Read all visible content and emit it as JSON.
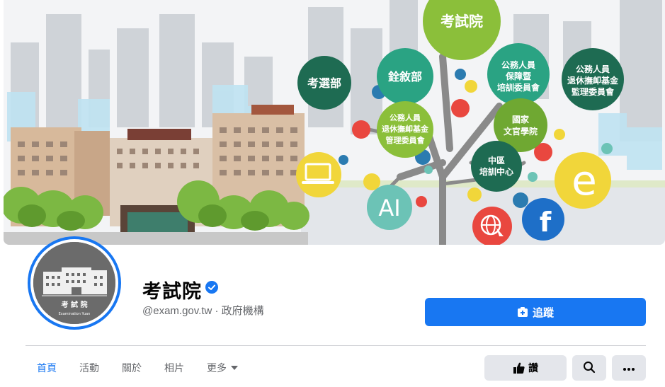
{
  "cover": {
    "bubbles": {
      "exam_yuan": "考試院",
      "ministry_exam": "考選部",
      "ministry_civil": "銓敘部",
      "protection": [
        "公務人員",
        "保障暨",
        "培訓委員會"
      ],
      "pension_supervisory": [
        "公務人員",
        "退休撫卹基金",
        "監理委員會"
      ],
      "pension_management": [
        "公務人員",
        "退休撫卹基金",
        "管理委員會"
      ],
      "academy": [
        "國家",
        "文官學院"
      ],
      "central_training": [
        "中區",
        "培訓中心"
      ],
      "ai": "AI",
      "facebook": "f",
      "edge": "e"
    },
    "colors": {
      "dark_green": "#1e6b52",
      "teal": "#2aa383",
      "light_green": "#8bbf3a",
      "olive_green": "#6fa832",
      "ai_teal": "#6cc3b6",
      "yellow": "#f1d63a",
      "facebook_blue": "#1e6fc8",
      "red": "#e9473f"
    },
    "avatar_text": "考 試 院",
    "avatar_subtext": "Examination Yuan"
  },
  "profile": {
    "name": "考試院",
    "handle": "@exam.gov.tw · 政府機構",
    "verified_icon": "verified-badge-icon"
  },
  "actions": {
    "follow_label": "追蹤",
    "like_label": "讚"
  },
  "tabs": [
    {
      "label": "首頁",
      "active": true
    },
    {
      "label": "活動",
      "active": false
    },
    {
      "label": "關於",
      "active": false
    },
    {
      "label": "相片",
      "active": false
    },
    {
      "label": "更多",
      "active": false
    }
  ],
  "accent_color": "#1877f2"
}
